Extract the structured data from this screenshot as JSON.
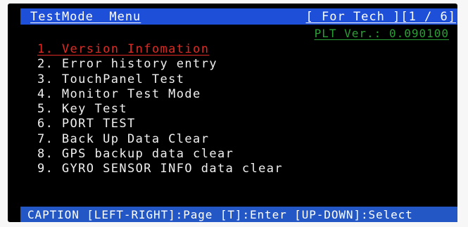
{
  "header": {
    "title": "TestMode  Menu",
    "tag": "[ For Tech ][1 / 6]"
  },
  "version": "PLT Ver.: 0.090100",
  "menu": {
    "items": [
      {
        "label": "1. Version Infomation",
        "selected": true
      },
      {
        "label": "2. Error history entry",
        "selected": false
      },
      {
        "label": "3. TouchPanel Test",
        "selected": false
      },
      {
        "label": "4. Monitor Test Mode",
        "selected": false
      },
      {
        "label": "5. Key Test",
        "selected": false
      },
      {
        "label": "6. PORT TEST",
        "selected": false
      },
      {
        "label": "7. Back Up Data Clear",
        "selected": false
      },
      {
        "label": "8. GPS backup data clear",
        "selected": false
      },
      {
        "label": "9. GYRO SENSOR INFO data clear",
        "selected": false
      }
    ]
  },
  "caption": "CAPTION [LEFT-RIGHT]:Page [T]:Enter [UP-DOWN]:Select",
  "colors": {
    "background": "#000000",
    "header_bar": "#1e4fd8",
    "caption_bar": "#2457c6",
    "selected_text": "#e02a24",
    "version_text": "#2aa036",
    "normal_text": "#f0f0f0"
  }
}
